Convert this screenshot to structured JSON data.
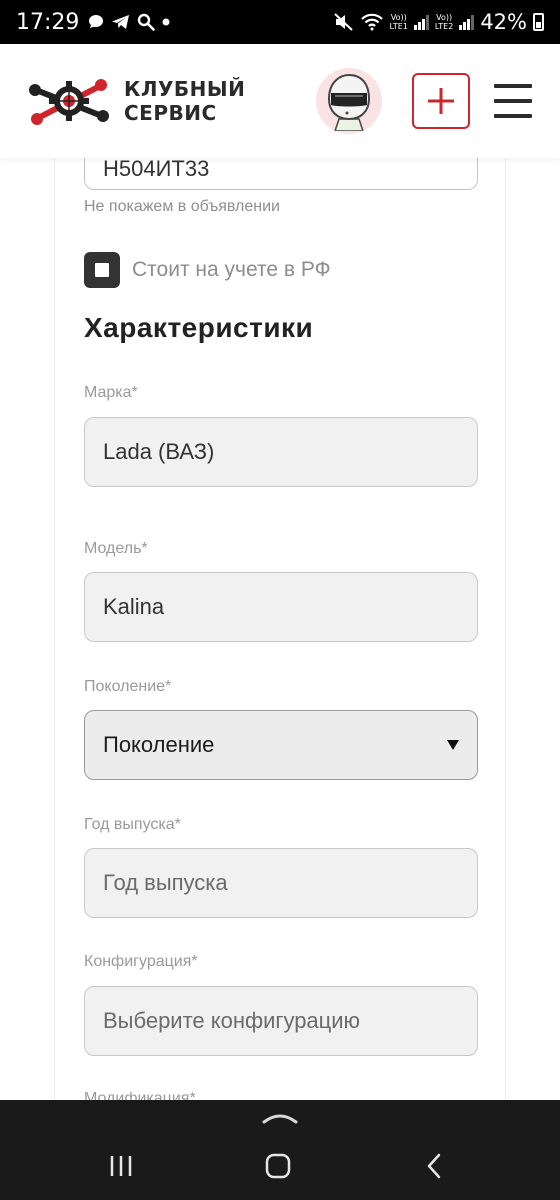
{
  "status_bar": {
    "time": "17:29",
    "sim1": "LTE1",
    "sim2": "LTE2",
    "volte": "Vo))",
    "battery_percent": "42%"
  },
  "header": {
    "logo_line1": "КЛУБНЫЙ",
    "logo_line2": "СЕРВИС",
    "accent_color": "#c8282d",
    "avatar_icon": "helmet-avatar-icon",
    "add_icon": "plus-icon",
    "menu_icon": "hamburger-menu-icon"
  },
  "form": {
    "partial_field_value": "Н504ИТ33",
    "partial_field_hint": "Не покажем в объявлении",
    "registered_checkbox_label": "Стоит на учете в РФ",
    "registered_checked": true,
    "section_title": "Характеристики",
    "brand_label": "Марка*",
    "brand_value": "Lada (ВАЗ)",
    "model_label": "Модель*",
    "model_value": "Kalina",
    "generation_label": "Поколение*",
    "generation_value": "Поколение",
    "year_label": "Год выпуска*",
    "year_placeholder": "Год выпуска",
    "configuration_label": "Конфигурация*",
    "configuration_placeholder": "Выберите конфигурацию",
    "modification_label": "Модификация*"
  },
  "nav_bar": {
    "recents_icon": "recents-icon",
    "home_icon": "home-icon",
    "back_icon": "back-icon",
    "handle_icon": "chevron-up-icon"
  }
}
